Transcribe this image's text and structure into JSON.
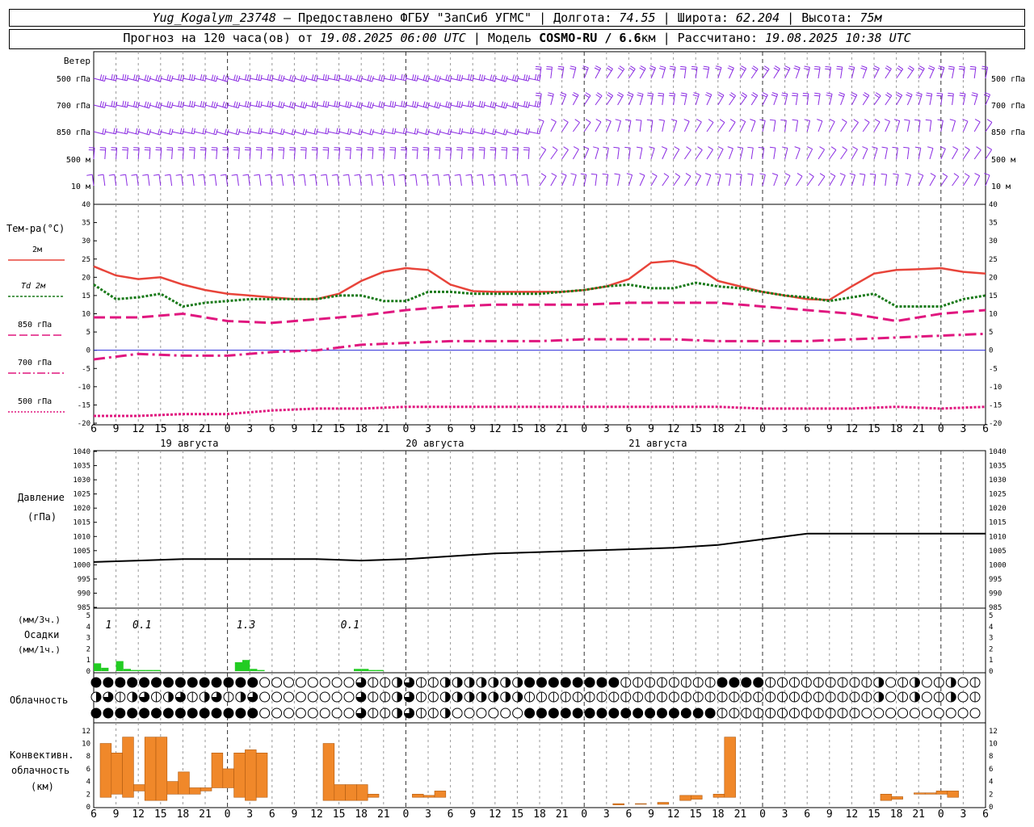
{
  "header": {
    "station": "Yug_Kogalym_23748",
    "provider": "— Предоставлено ФГБУ \"ЗапСиб УГМС\" |",
    "lon_label": "Долгота:",
    "lon": "74.55",
    "lat_label": "| Широта:",
    "lat": "62.204",
    "alt_label": "| Высота:",
    "alt": "75м",
    "forecast_label": "Прогноз на 120 часа(ов) от",
    "forecast_start": "19.08.2025 06:00 UTC",
    "model_label": "| Модель",
    "model": "COSMO-RU / 6.6",
    "model_unit": "км",
    "calc_label": "| Рассчитано:",
    "calc_time": "19.08.2025 10:38 UTC"
  },
  "wind": {
    "title": "Ветер",
    "levels": [
      "500 гПа",
      "700 гПа",
      "850 гПа",
      "500 м",
      "10  м"
    ]
  },
  "temp": {
    "title": "Тем-ра(°C)",
    "legend": [
      "2м",
      "Td 2м",
      "850 гПа",
      "700 гПа",
      "500 гПа"
    ],
    "ticks": [
      "40",
      "35",
      "30",
      "25",
      "20",
      "15",
      "10",
      "5",
      "0",
      "-5",
      "-10",
      "-15",
      "-20"
    ]
  },
  "time_axis": {
    "hour_labels": [
      "6",
      "9",
      "12",
      "15",
      "18",
      "21",
      "0",
      "3",
      "6",
      "9",
      "12",
      "15",
      "18",
      "21",
      "0",
      "3",
      "6",
      "9",
      "12",
      "15",
      "18",
      "21",
      "0",
      "3",
      "6",
      "9",
      "12"
    ],
    "dates": [
      "19 августа",
      "20 августа",
      "21 августа"
    ]
  },
  "pressure": {
    "title1": "Давление",
    "title2": "(гПа)",
    "ticks": [
      "1040",
      "1035",
      "1030",
      "1025",
      "1020",
      "1015",
      "1010",
      "1005",
      "1000",
      "995",
      "990",
      "985"
    ]
  },
  "precip": {
    "title1": "(мм/3ч.)",
    "title2": "Осадки",
    "title3": "(мм/1ч.)",
    "ticks": [
      "5",
      "4",
      "3",
      "2",
      "1",
      "0"
    ],
    "labels_3h": [
      "1",
      "0.1",
      "1.3",
      "0.1"
    ]
  },
  "clouds": {
    "title": "Облачность"
  },
  "conv": {
    "title1": "Конвективн.",
    "title2": "облачность",
    "title3": "(км)",
    "ticks": [
      "12",
      "10",
      "8",
      "6",
      "4",
      "2",
      "0"
    ]
  },
  "colors": {
    "t2m": "#e8443a",
    "td2m": "#1a7a1a",
    "t850": "#e0177f",
    "t700": "#e0177f",
    "t500": "#e0177f",
    "wind": "#8a2be2",
    "precip": "#22cc22",
    "conv": "#f0882a",
    "pressure": "#000000"
  },
  "chart_data": [
    {
      "type": "line",
      "name": "temperature",
      "x_unit": "hours from 19.08.2025 06:00 UTC",
      "ylim": [
        -20,
        40
      ],
      "series": [
        {
          "name": "2м",
          "x": [
            0,
            3,
            6,
            9,
            12,
            15,
            18,
            21,
            24,
            27,
            30,
            33,
            36,
            39,
            42,
            45,
            48,
            51,
            54,
            57,
            60,
            63,
            66,
            69,
            72,
            75,
            78,
            81,
            84,
            87,
            90,
            93,
            96,
            99,
            102,
            105,
            108,
            111,
            114,
            117,
            120
          ],
          "values": [
            23,
            20.5,
            19.5,
            20,
            18,
            16.5,
            15.5,
            15,
            14.5,
            14,
            14,
            15.5,
            19,
            21.5,
            22.5,
            22,
            18,
            16.2,
            16,
            16,
            16,
            16,
            16.5,
            17.5,
            19.5,
            24,
            24.5,
            23,
            19,
            17.5,
            16,
            15,
            14,
            13.8,
            17.5,
            21,
            22,
            22.2,
            22.5,
            21.5,
            21
          ]
        },
        {
          "name": "Td 2м",
          "x": [
            0,
            3,
            6,
            9,
            12,
            15,
            18,
            21,
            24,
            27,
            30,
            33,
            36,
            39,
            42,
            45,
            48,
            51,
            54,
            57,
            60,
            63,
            66,
            69,
            72,
            75,
            78,
            81,
            84,
            87,
            90,
            93,
            96,
            99,
            102,
            105,
            108,
            111,
            114,
            117,
            120
          ],
          "values": [
            18,
            14,
            14.5,
            15.5,
            12,
            13,
            13.5,
            14,
            14,
            14,
            14,
            15,
            15,
            13.5,
            13.5,
            16,
            16,
            15.5,
            15.5,
            15.5,
            15.5,
            16,
            16.5,
            17.5,
            18,
            17,
            17,
            18.5,
            17.5,
            17,
            16,
            15,
            14.5,
            13.5,
            14.5,
            15.5,
            12,
            12,
            12,
            14,
            15
          ]
        },
        {
          "name": "850 гПа",
          "x": [
            0,
            6,
            12,
            18,
            24,
            30,
            36,
            42,
            48,
            54,
            60,
            66,
            72,
            78,
            84,
            90,
            96,
            102,
            108,
            114,
            120
          ],
          "values": [
            9,
            9,
            10,
            8,
            7.5,
            8.5,
            9.5,
            11,
            12,
            12.5,
            12.5,
            12.5,
            13,
            13,
            13,
            12,
            11,
            10,
            8,
            10,
            11
          ]
        },
        {
          "name": "700 гПа",
          "x": [
            0,
            6,
            12,
            18,
            24,
            30,
            36,
            42,
            48,
            54,
            60,
            66,
            72,
            78,
            84,
            90,
            96,
            102,
            108,
            114,
            120
          ],
          "values": [
            -2.5,
            -1,
            -1.5,
            -1.5,
            -0.5,
            0,
            1.5,
            2,
            2.5,
            2.5,
            2.5,
            3,
            3,
            3,
            2.5,
            2.5,
            2.5,
            3,
            3.5,
            4,
            4.5
          ]
        },
        {
          "name": "500 гПа",
          "x": [
            0,
            6,
            12,
            18,
            24,
            30,
            36,
            42,
            48,
            54,
            60,
            66,
            72,
            78,
            84,
            90,
            96,
            102,
            108,
            114,
            120
          ],
          "values": [
            -18,
            -18,
            -17.5,
            -17.5,
            -16.5,
            -16,
            -16,
            -15.5,
            -15.5,
            -15.5,
            -15.5,
            -15.5,
            -15.5,
            -15.5,
            -15.5,
            -16,
            -16,
            -16,
            -15.5,
            -16,
            -15.5
          ]
        }
      ]
    },
    {
      "type": "line",
      "name": "pressure",
      "ylim": [
        985,
        1040
      ],
      "x": [
        0,
        6,
        12,
        18,
        24,
        30,
        36,
        42,
        48,
        54,
        60,
        66,
        72,
        78,
        84,
        90,
        96,
        102,
        108,
        114,
        120
      ],
      "values": [
        1001,
        1001.5,
        1002,
        1002,
        1002,
        1002,
        1001.5,
        1002,
        1003,
        1004,
        1004.5,
        1005,
        1005.5,
        1006,
        1007,
        1009,
        1011,
        1011,
        1011,
        1011,
        1011
      ]
    },
    {
      "type": "bar",
      "name": "precipitation_1h",
      "ylim": [
        0,
        5
      ],
      "x": [
        0,
        1,
        3,
        4,
        5,
        6,
        7,
        8,
        19,
        20,
        21,
        22,
        35,
        36,
        37,
        38
      ],
      "values": [
        0.7,
        0.3,
        0.9,
        0.2,
        0.1,
        0.1,
        0.1,
        0.1,
        0.8,
        1.0,
        0.2,
        0.1,
        0.2,
        0.2,
        0.1,
        0.1
      ]
    },
    {
      "type": "bar",
      "name": "convective_cloud_km",
      "ylim": [
        0,
        13
      ],
      "bars": [
        {
          "x": 0,
          "low": 1.5,
          "high": 10
        },
        {
          "x": 1.5,
          "low": 2,
          "high": 8.5
        },
        {
          "x": 3,
          "low": 1.5,
          "high": 11
        },
        {
          "x": 4.5,
          "low": 2.5,
          "high": 3.5
        },
        {
          "x": 6,
          "low": 1,
          "high": 11
        },
        {
          "x": 7.5,
          "low": 1,
          "high": 11
        },
        {
          "x": 9,
          "low": 2,
          "high": 4
        },
        {
          "x": 10.5,
          "low": 2,
          "high": 5.5
        },
        {
          "x": 12,
          "low": 2,
          "high": 3
        },
        {
          "x": 13.5,
          "low": 2.5,
          "high": 3
        },
        {
          "x": 15,
          "low": 3,
          "high": 8.5
        },
        {
          "x": 16.5,
          "low": 3,
          "high": 6
        },
        {
          "x": 18,
          "low": 1.5,
          "high": 8.5
        },
        {
          "x": 19.5,
          "low": 1,
          "high": 9
        },
        {
          "x": 21,
          "low": 1.5,
          "high": 8.5
        },
        {
          "x": 30,
          "low": 1,
          "high": 10
        },
        {
          "x": 31.5,
          "low": 1,
          "high": 3.5
        },
        {
          "x": 33,
          "low": 1,
          "high": 3.5
        },
        {
          "x": 34.5,
          "low": 1,
          "high": 3.5
        },
        {
          "x": 36,
          "low": 1.5,
          "high": 2
        },
        {
          "x": 42,
          "low": 1.5,
          "high": 2
        },
        {
          "x": 43.5,
          "low": 1.5,
          "high": 1.8
        },
        {
          "x": 45,
          "low": 1.5,
          "high": 2.5
        },
        {
          "x": 69,
          "low": 0.3,
          "high": 0.5
        },
        {
          "x": 72,
          "low": 0.4,
          "high": 0.5
        },
        {
          "x": 75,
          "low": 0.4,
          "high": 0.7
        },
        {
          "x": 78,
          "low": 1,
          "high": 1.8
        },
        {
          "x": 79.5,
          "low": 1.2,
          "high": 1.8
        },
        {
          "x": 82.5,
          "low": 1.5,
          "high": 2
        },
        {
          "x": 84,
          "low": 1.5,
          "high": 11
        },
        {
          "x": 105,
          "low": 1,
          "high": 2
        },
        {
          "x": 106.5,
          "low": 1.2,
          "high": 1.6
        },
        {
          "x": 109.5,
          "low": 2,
          "high": 2.2
        },
        {
          "x": 111,
          "low": 2,
          "high": 2.2
        },
        {
          "x": 112.5,
          "low": 2,
          "high": 2.5
        },
        {
          "x": 114,
          "low": 1.5,
          "high": 2.5
        }
      ]
    }
  ]
}
